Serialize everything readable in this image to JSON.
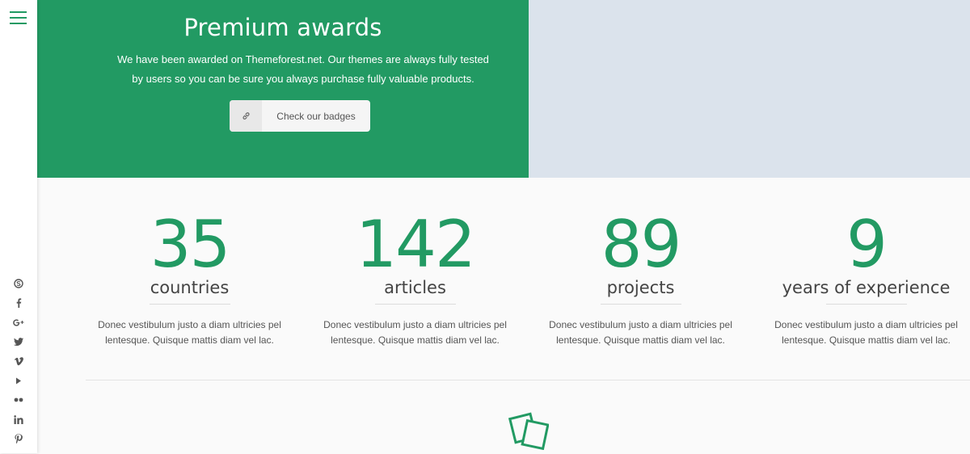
{
  "sidebar": {
    "social_icons": [
      "skype-icon",
      "facebook-icon",
      "google-plus-icon",
      "twitter-icon",
      "vimeo-icon",
      "youtube-icon",
      "flickr-icon",
      "linkedin-icon",
      "pinterest-icon"
    ]
  },
  "hero": {
    "title": "Premium awards",
    "text_line1": "We have been awarded on Themeforest.net. Our themes are always fully tested",
    "text_line2": "by users so you can be sure you always purchase fully valuable products.",
    "button_label": "Check our badges",
    "green": "#229a63",
    "gray_panel": "#dbe3ec"
  },
  "counters": [
    {
      "number": "35",
      "label": "countries",
      "desc1": "Donec vestibulum justo a diam ultricies pel",
      "desc2": "lentesque. Quisque mattis diam vel lac."
    },
    {
      "number": "142",
      "label": "articles",
      "desc1": "Donec vestibulum justo a diam ultricies pel",
      "desc2": "lentesque. Quisque mattis diam vel lac."
    },
    {
      "number": "89",
      "label": "projects",
      "desc1": "Donec vestibulum justo a diam ultricies pel",
      "desc2": "lentesque. Quisque mattis diam vel lac."
    },
    {
      "number": "9",
      "label": "years of experience",
      "desc1": "Donec vestibulum justo a diam ultricies pel",
      "desc2": "lentesque. Quisque mattis diam vel lac."
    }
  ],
  "bottom": {
    "icon": "cards-icon"
  }
}
